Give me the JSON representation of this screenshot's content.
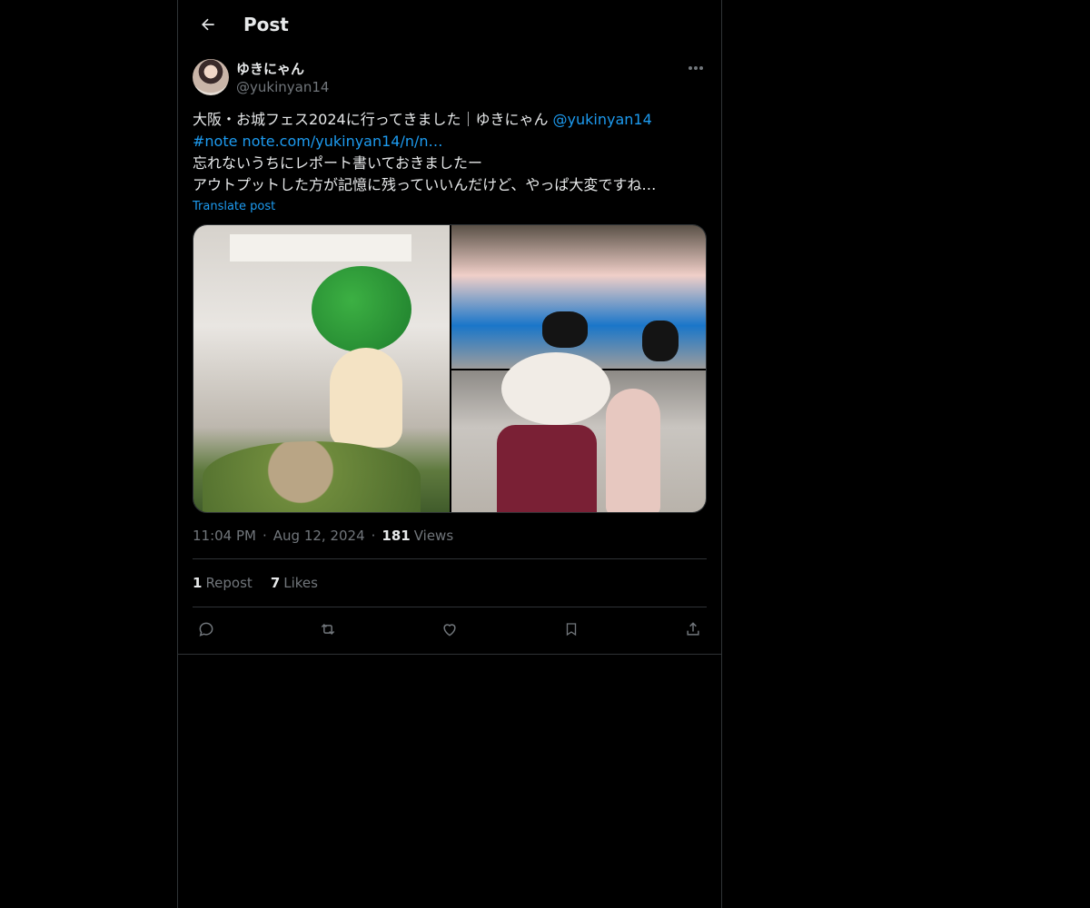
{
  "header": {
    "title": "Post"
  },
  "author": {
    "display_name": "ゆきにゃん",
    "handle": "@yukinyan14"
  },
  "tweet": {
    "line1_text": "大阪・お城フェス2024に行ってきました｜ゆきにゃん ",
    "line1_mention": "@yukinyan14",
    "line2_hashtag": "#note",
    "line2_link": "note.com/yukinyan14/n/n…",
    "line3": "忘れないうちにレポート書いておきましたー",
    "line4": "アウトプットした方が記憶に残っていいんだけど、やっぱ大変ですね…",
    "translate_label": "Translate post"
  },
  "meta": {
    "time": "11:04 PM",
    "date": "Aug 12, 2024",
    "views_count": "181",
    "views_label": "Views"
  },
  "stats": {
    "reposts_count": "1",
    "reposts_label": "Repost",
    "likes_count": "7",
    "likes_label": "Likes"
  },
  "colors": {
    "background": "#000000",
    "text": "#e7e9ea",
    "muted": "#71767b",
    "accent": "#1d9bf0",
    "border": "#2f3336"
  },
  "icons": {
    "back": "arrow-left-icon",
    "more": "more-horizontal-icon",
    "reply": "reply-icon",
    "repost": "repost-icon",
    "like": "heart-icon",
    "bookmark": "bookmark-icon",
    "share": "share-icon"
  }
}
